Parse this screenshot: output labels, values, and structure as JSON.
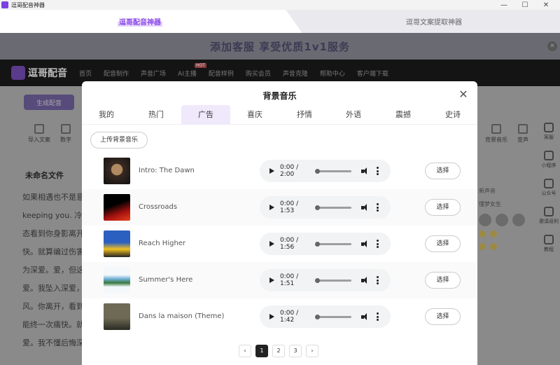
{
  "window": {
    "title": "逗哥配音神器"
  },
  "top_tabs": [
    {
      "label": "逗哥配音神器",
      "active": true
    },
    {
      "label": "逗哥文案提取神器",
      "active": false
    }
  ],
  "background": {
    "banner_text": "添加客服 享受优质1v1服务",
    "logo": "逗哥配音",
    "nav": [
      "首页",
      "配音制作",
      "声音广场",
      "AI主播",
      "配音样例",
      "购买会员",
      "声音克隆",
      "帮助中心",
      "客户端下载"
    ],
    "nav_badges": {
      "hot": "HOT"
    },
    "generate_button": "生成配音",
    "tools": [
      "导入文案",
      "数字",
      "背景音乐",
      "变声"
    ],
    "doc_title": "未命名文件",
    "text_lines": [
      "如果相遇也不是意",
      "keeping you. 冷",
      "态看到你身影离开",
      "快。就算编过伤害",
      "为深爱。爱，但这",
      "爱。我坠入深爱，",
      "风。你离开，看到",
      "能终一次痛快。就",
      "爱。我不懂后悔深"
    ],
    "rail": [
      "客服",
      "小程序",
      "公众号",
      "邀请返利",
      "教程"
    ],
    "right_panel": [
      "新声音",
      "懂梦女生"
    ]
  },
  "modal": {
    "title": "背景音乐",
    "categories": [
      "我的",
      "热门",
      "广告",
      "喜庆",
      "抒情",
      "外语",
      "震撼",
      "史诗"
    ],
    "active_category": "广告",
    "upload_label": "上传背景音乐",
    "select_label": "选择",
    "tracks": [
      {
        "name": "Intro: The Dawn",
        "time": "0:00 / 2:00",
        "cover": "#3a2a22"
      },
      {
        "name": "Crossroads",
        "time": "0:00 / 1:53",
        "cover": "#5a0e0e"
      },
      {
        "name": "Reach Higher",
        "time": "0:00 / 1:56",
        "cover": "#2a4aa0"
      },
      {
        "name": "Summer's Here",
        "time": "0:00 / 1:51",
        "cover": "#e7eef5"
      },
      {
        "name": "Dans la maison (Theme)",
        "time": "0:00 / 1:42",
        "cover": "#4a4838"
      }
    ],
    "pages": [
      "1",
      "2",
      "3"
    ],
    "active_page": "1"
  }
}
